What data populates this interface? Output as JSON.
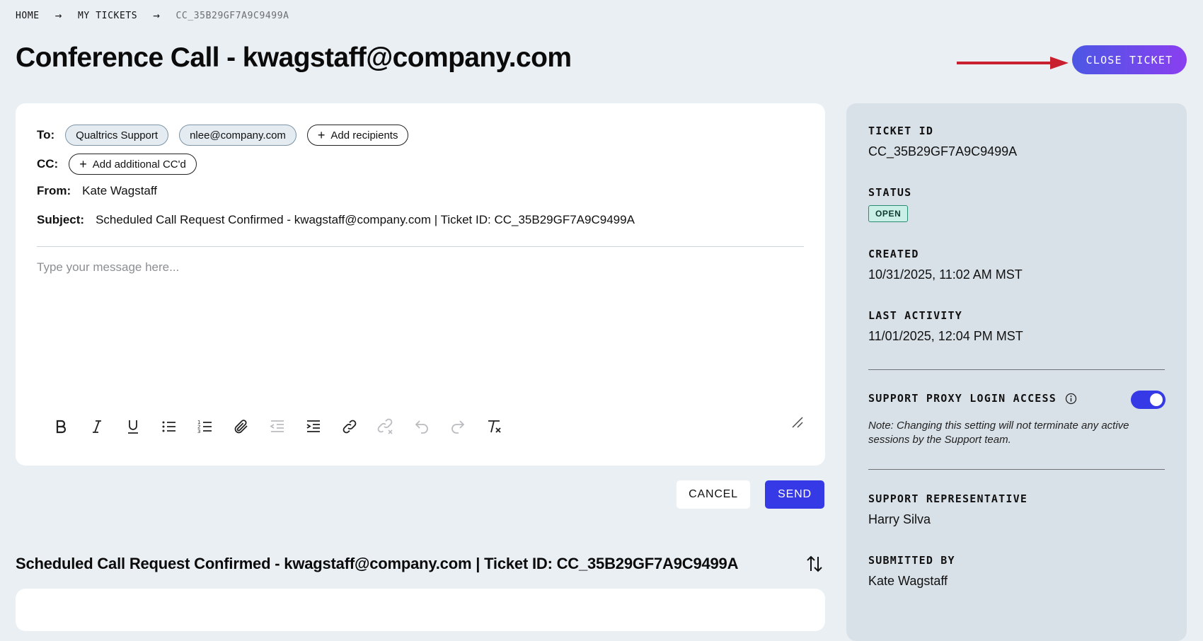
{
  "breadcrumb": {
    "home": "HOME",
    "my_tickets": "MY TICKETS",
    "current": "CC_35B29GF7A9C9499A"
  },
  "header": {
    "title": "Conference Call - kwagstaff@company.com",
    "close_label": "CLOSE TICKET",
    "arrow_color": "#c8202f"
  },
  "compose": {
    "to_label": "To:",
    "to_recipients": [
      "Qualtrics Support",
      "nlee@company.com"
    ],
    "add_recipients": "Add recipients",
    "cc_label": "CC:",
    "add_cc": "Add additional CC'd",
    "from_label": "From:",
    "from_value": "Kate Wagstaff",
    "subject_label": "Subject:",
    "subject_value": "Scheduled Call Request Confirmed - kwagstaff@company.com | Ticket ID: CC_35B29GF7A9C9499A",
    "placeholder": "Type your message here...",
    "toolbar": [
      "bold-icon",
      "italic-icon",
      "underline-icon",
      "bullet-list-icon",
      "numbered-list-icon",
      "attachment-icon",
      "outdent-icon",
      "indent-icon",
      "link-icon",
      "unlink-icon",
      "undo-icon",
      "redo-icon",
      "clear-format-icon"
    ]
  },
  "actions": {
    "cancel": "CANCEL",
    "send": "SEND"
  },
  "thread": {
    "title": "Scheduled Call Request Confirmed - kwagstaff@company.com | Ticket ID: CC_35B29GF7A9C9499A"
  },
  "side": {
    "ticket_id_label": "TICKET ID",
    "ticket_id": "CC_35B29GF7A9C9499A",
    "status_label": "STATUS",
    "status": "OPEN",
    "created_label": "CREATED",
    "created": "10/31/2025, 11:02 AM MST",
    "last_activity_label": "LAST ACTIVITY",
    "last_activity": "11/01/2025, 12:04 PM MST",
    "proxy_label": "SUPPORT PROXY LOGIN ACCESS",
    "proxy_enabled": true,
    "proxy_note": "Note: Changing this setting will not terminate any active sessions by the Support team.",
    "rep_label": "SUPPORT REPRESENTATIVE",
    "rep": "Harry Silva",
    "submitted_label": "SUBMITTED BY",
    "submitted": "Kate Wagstaff"
  },
  "colors": {
    "accent": "#3539e6",
    "close_gradient_start": "#4c57e4",
    "close_gradient_end": "#8a3ff0",
    "status_bg": "#c9efe6"
  }
}
